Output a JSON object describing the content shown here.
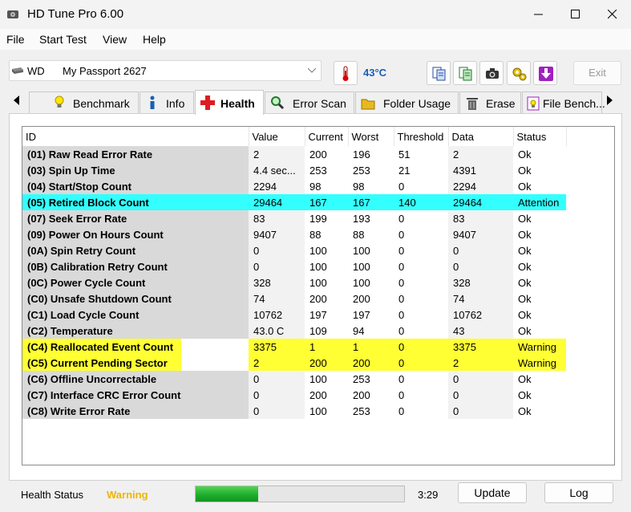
{
  "window": {
    "title": "HD Tune Pro 6.00"
  },
  "menu": [
    "File",
    "Start Test",
    "View",
    "Help"
  ],
  "toolbar": {
    "drive_brand": "WD",
    "drive_model": "My Passport 2627",
    "temperature": "43°C",
    "exit_label": "Exit"
  },
  "tabs": [
    {
      "label": "Benchmark",
      "icon": "lightbulb-icon",
      "active": false
    },
    {
      "label": "Info",
      "icon": "info-icon",
      "active": false
    },
    {
      "label": "Health",
      "icon": "health-cross-icon",
      "active": true
    },
    {
      "label": "Error Scan",
      "icon": "magnifier-icon",
      "active": false
    },
    {
      "label": "Folder Usage",
      "icon": "folder-icon",
      "active": false
    },
    {
      "label": "Erase",
      "icon": "trash-icon",
      "active": false
    },
    {
      "label": "File Bench...",
      "icon": "file-bench-icon",
      "active": false
    }
  ],
  "table": {
    "columns": [
      "ID",
      "Value",
      "Current",
      "Worst",
      "Threshold",
      "Data",
      "Status"
    ],
    "rows": [
      {
        "id": "(01) Raw Read Error Rate",
        "value": "2",
        "current": "200",
        "worst": "196",
        "threshold": "51",
        "data": "2",
        "status": "Ok",
        "highlight": ""
      },
      {
        "id": "(03) Spin Up Time",
        "value": "4.4 sec...",
        "current": "253",
        "worst": "253",
        "threshold": "21",
        "data": "4391",
        "status": "Ok",
        "highlight": ""
      },
      {
        "id": "(04) Start/Stop Count",
        "value": "2294",
        "current": "98",
        "worst": "98",
        "threshold": "0",
        "data": "2294",
        "status": "Ok",
        "highlight": ""
      },
      {
        "id": "(05) Retired Block Count",
        "value": "29464",
        "current": "167",
        "worst": "167",
        "threshold": "140",
        "data": "29464",
        "status": "Attention",
        "highlight": "attention"
      },
      {
        "id": "(07) Seek Error Rate",
        "value": "83",
        "current": "199",
        "worst": "193",
        "threshold": "0",
        "data": "83",
        "status": "Ok",
        "highlight": ""
      },
      {
        "id": "(09) Power On Hours Count",
        "value": "9407",
        "current": "88",
        "worst": "88",
        "threshold": "0",
        "data": "9407",
        "status": "Ok",
        "highlight": ""
      },
      {
        "id": "(0A) Spin Retry Count",
        "value": "0",
        "current": "100",
        "worst": "100",
        "threshold": "0",
        "data": "0",
        "status": "Ok",
        "highlight": ""
      },
      {
        "id": "(0B) Calibration Retry Count",
        "value": "0",
        "current": "100",
        "worst": "100",
        "threshold": "0",
        "data": "0",
        "status": "Ok",
        "highlight": ""
      },
      {
        "id": "(0C) Power Cycle Count",
        "value": "328",
        "current": "100",
        "worst": "100",
        "threshold": "0",
        "data": "328",
        "status": "Ok",
        "highlight": ""
      },
      {
        "id": "(C0) Unsafe Shutdown Count",
        "value": "74",
        "current": "200",
        "worst": "200",
        "threshold": "0",
        "data": "74",
        "status": "Ok",
        "highlight": ""
      },
      {
        "id": "(C1) Load Cycle Count",
        "value": "10762",
        "current": "197",
        "worst": "197",
        "threshold": "0",
        "data": "10762",
        "status": "Ok",
        "highlight": ""
      },
      {
        "id": "(C2) Temperature",
        "value": "43.0 C",
        "current": "109",
        "worst": "94",
        "threshold": "0",
        "data": "43",
        "status": "Ok",
        "highlight": ""
      },
      {
        "id": "(C4) Reallocated Event Count",
        "value": "3375",
        "current": "1",
        "worst": "1",
        "threshold": "0",
        "data": "3375",
        "status": "Warning",
        "highlight": "warning"
      },
      {
        "id": "(C5) Current Pending Sector",
        "value": "2",
        "current": "200",
        "worst": "200",
        "threshold": "0",
        "data": "2",
        "status": "Warning",
        "highlight": "warning"
      },
      {
        "id": "(C6) Offline Uncorrectable",
        "value": "0",
        "current": "100",
        "worst": "253",
        "threshold": "0",
        "data": "0",
        "status": "Ok",
        "highlight": ""
      },
      {
        "id": "(C7) Interface CRC Error Count",
        "value": "0",
        "current": "200",
        "worst": "200",
        "threshold": "0",
        "data": "0",
        "status": "Ok",
        "highlight": ""
      },
      {
        "id": "(C8) Write Error Rate",
        "value": "0",
        "current": "100",
        "worst": "253",
        "threshold": "0",
        "data": "0",
        "status": "Ok",
        "highlight": ""
      }
    ]
  },
  "status_bar": {
    "health_label": "Health Status",
    "health_value": "Warning",
    "progress_fraction": 0.3,
    "time": "3:29",
    "update_label": "Update",
    "log_label": "Log"
  },
  "colors": {
    "attention": "#33ffff",
    "warning": "#ffff33",
    "warning_text": "#f0b400",
    "temperature_text": "#1a5fb4"
  }
}
